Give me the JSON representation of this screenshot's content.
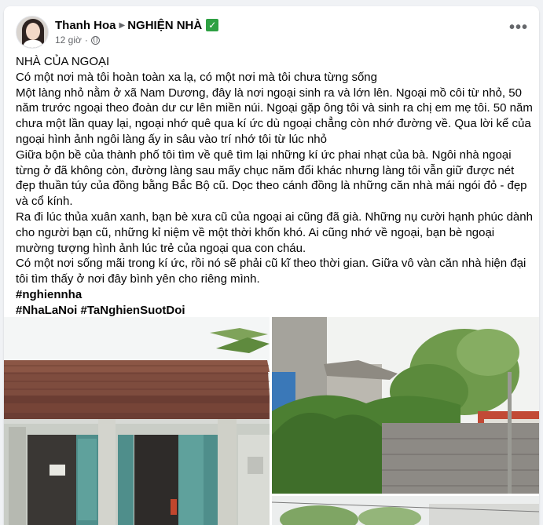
{
  "post": {
    "author": "Thanh Hoa",
    "group": "NGHIỆN NHÀ",
    "verified_mark": "✓",
    "time": "12 giờ",
    "dot": "·",
    "privacy_icon": "globe-icon",
    "more_icon": "more-options-icon",
    "more_label": "•••"
  },
  "content": {
    "title": "NHÀ CỦA NGOẠI",
    "paragraphs": [
      "Có một nơi mà tôi hoàn toàn xa lạ, có một nơi mà tôi chưa từng sống",
      "Một làng nhỏ nằm ở xã Nam Dương, đây là nơi ngoại sinh ra và lớn lên. Ngoại mồ côi từ nhỏ, 50 năm trước ngoại theo đoàn dư cư lên miền núi. Ngoại gặp ông tôi và sinh ra chị em mẹ tôi. 50 năm chưa một lần quay lại, ngoại nhớ quê qua kí ức dù ngoại chẳng còn nhớ đường về. Qua lời kể của ngoại hình ảnh ngôi làng ấy in sâu vào trí nhớ tôi từ lúc nhỏ",
      "Giữa bộn bề của thành phố tôi tìm về quê tìm lại những kí ức phai nhạt của bà. Ngôi nhà ngoại từng ở đã không còn, đường làng sau mấy chục năm đổi khác nhưng làng tôi vẫn giữ được nét đẹp thuần túy của đồng bằng Bắc Bộ cũ. Dọc theo cánh đồng là những căn nhà mái ngói đỏ - đẹp và cổ kính.",
      "Ra đi lúc thủa xuân xanh, bạn bè xưa cũ của ngoại ai cũng đã già. Những nụ cười hạnh phúc dành cho người bạn cũ, những kỉ niệm về một thời khốn khó. Ai cũng nhớ về ngoại, bạn bè ngoại mường tượng hình ảnh lúc trẻ của ngoại qua con cháu.",
      "Có một nơi sống mãi trong kí ức, rồi nó sẽ phải cũ kĩ theo thời gian. Giữa vô vàn căn nhà hiện đại tôi tìm thấy ở nơi đây bình yên cho riêng mình."
    ],
    "hashtag_1": "#nghiennha",
    "hashtag_2": "#NhaLaNoi #TaNghienSuotDoi"
  },
  "colors": {
    "text": "#050505",
    "secondary": "#65676b",
    "verified": "#2ea043",
    "background": "#f0f2f5"
  }
}
